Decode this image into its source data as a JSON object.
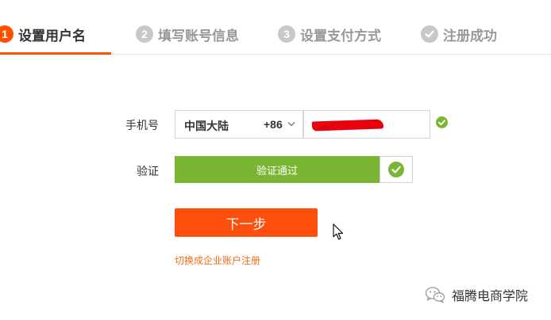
{
  "steps": [
    {
      "number": "1",
      "label": "设置用户名",
      "state": "active"
    },
    {
      "number": "2",
      "label": "填写账号信息",
      "state": "inactive"
    },
    {
      "number": "3",
      "label": "设置支付方式",
      "state": "inactive"
    },
    {
      "number": "",
      "label": "注册成功",
      "state": "inactive",
      "icon": "check-icon"
    }
  ],
  "form": {
    "phone_label": "手机号",
    "country_name": "中国大陆",
    "country_code": "+86",
    "verify_label": "验证",
    "verify_status": "验证通过",
    "next_button": "下一步",
    "switch_link": "切换成企业账户注册"
  },
  "watermark": {
    "text": "福腾电商学院",
    "icon": "wechat-icon"
  },
  "colors": {
    "accent": "#ff5000",
    "success": "#7ab534",
    "inactive": "#c8c8c8",
    "link": "#f06d17"
  }
}
